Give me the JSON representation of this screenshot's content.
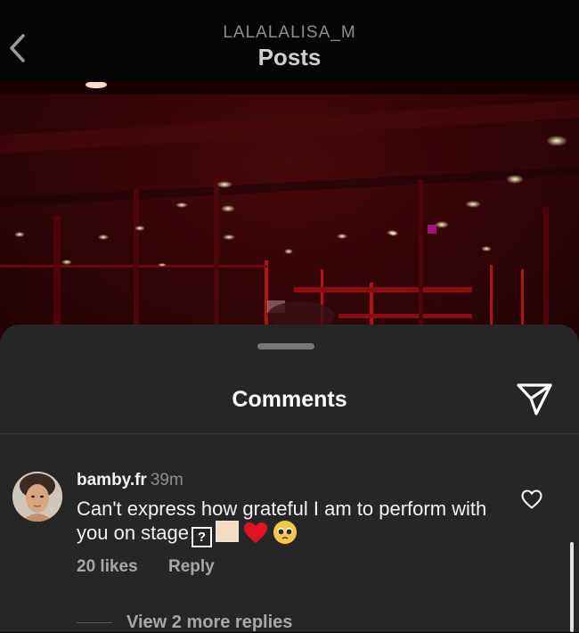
{
  "header": {
    "username": "LALALALISA_M",
    "title": "Posts",
    "back_icon": "chevron-left-icon"
  },
  "sheet": {
    "title": "Comments",
    "send_icon": "paper-plane-icon"
  },
  "comment": {
    "username": "bamby.fr",
    "time": "39m",
    "text": "Can't express how grateful I am to perform with you on stage",
    "emojis": [
      "unknown-emoji",
      "light-skin-tone",
      "red-heart",
      "pleading-face"
    ],
    "likes": "20 likes",
    "reply_label": "Reply",
    "view_replies": "View 2 more replies",
    "like_icon": "heart-outline-icon"
  },
  "colors": {
    "sheet_bg": "#262626",
    "accent_red": "#e0141e"
  }
}
